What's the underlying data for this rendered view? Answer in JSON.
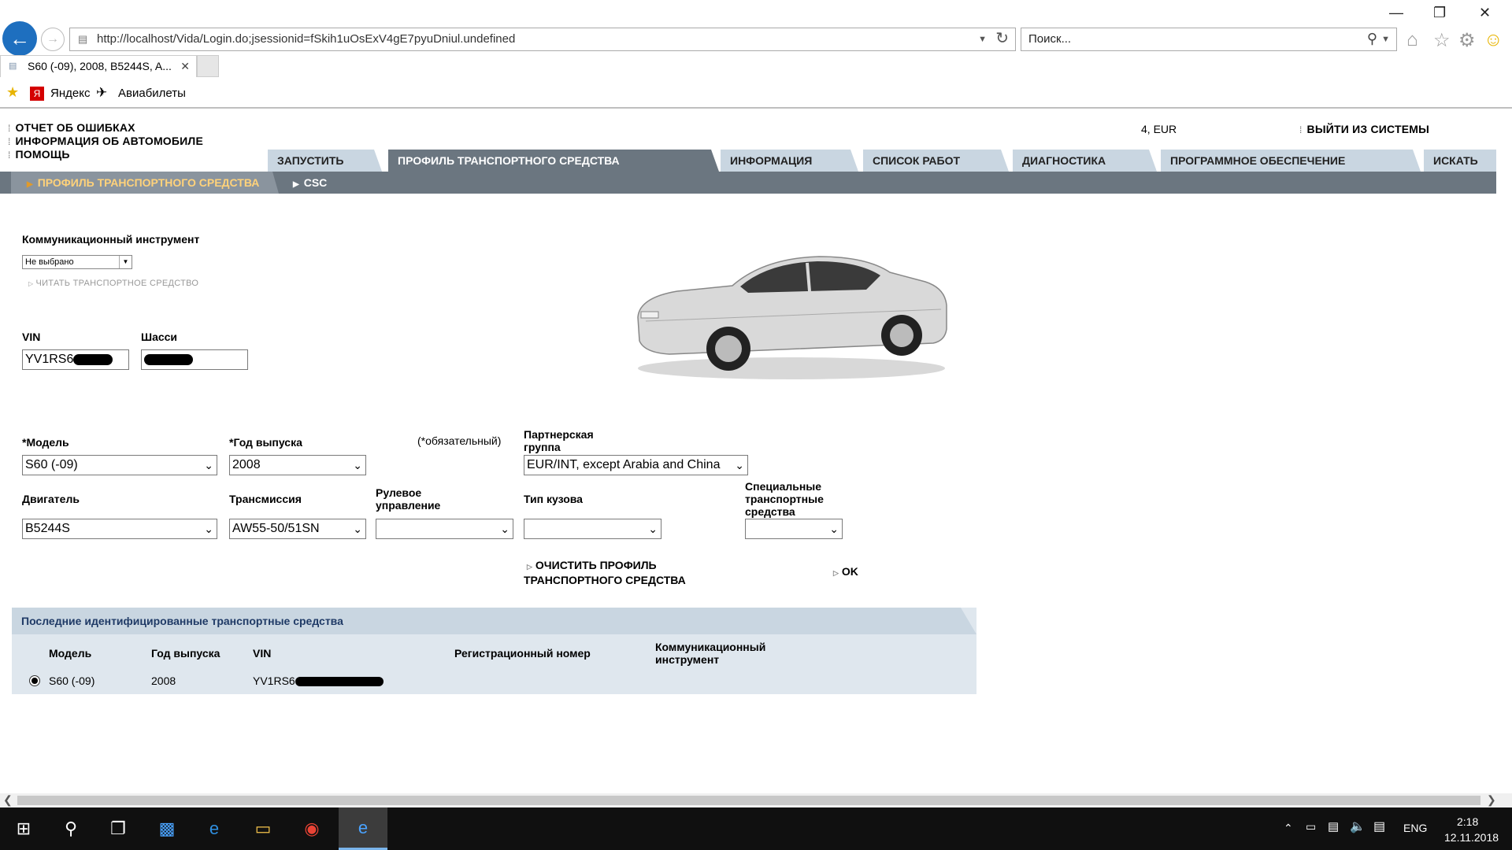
{
  "browser": {
    "address": "http://localhost/Vida/Login.do;jsessionid=fSkih1uOsExV4gE7pyuDniul.undefined",
    "search_placeholder": "Поиск...",
    "tab_title": "S60 (-09), 2008, B5244S, A...",
    "favorites": [
      "Яндекс",
      "Авиабилеты"
    ]
  },
  "header": {
    "links": [
      "ОТЧЕТ ОБ ОШИБКАХ",
      "ИНФОРМАЦИЯ ОБ АВТОМОБИЛЕ",
      "ПОМОЩЬ"
    ],
    "account": "4, EUR",
    "logout": "ВЫЙТИ ИЗ СИСТЕМЫ"
  },
  "menu": {
    "tabs": [
      "ЗАПУСТИТЬ",
      "ПРОФИЛЬ ТРАНСПОРТНОГО СРЕДСТВА",
      "ИНФОРМАЦИЯ",
      "СПИСОК РАБОТ",
      "ДИАГНОСТИКА",
      "ПРОГРАММНОЕ ОБЕСПЕЧЕНИЕ",
      "ИСКАТЬ"
    ],
    "active": "ПРОФИЛЬ ТРАНСПОРТНОГО СРЕДСТВА"
  },
  "submenu": {
    "items": [
      "ПРОФИЛЬ ТРАНСПОРТНОГО СРЕДСТВА",
      "CSC"
    ]
  },
  "comm": {
    "label": "Коммуникационный инструмент",
    "value": "Не выбрано",
    "read_link": "ЧИТАТЬ ТРАНСПОРТНОЕ СРЕДСТВО"
  },
  "vin": {
    "label": "VIN",
    "value": "YV1RS6"
  },
  "chassis": {
    "label": "Шасси",
    "value": ""
  },
  "profile": {
    "model_label": "*Модель",
    "model_value": "S60 (-09)",
    "year_label": "*Год выпуска",
    "year_value": "2008",
    "required_note": "(*обязательный)",
    "partner_label_1": "Партнерская",
    "partner_label_2": "группа",
    "partner_value": "EUR/INT, except Arabia and China",
    "engine_label": "Двигатель",
    "engine_value": "B5244S",
    "trans_label": "Трансмиссия",
    "trans_value": "AW55-50/51SN",
    "steering_label_1": "Рулевое",
    "steering_label_2": "управление",
    "steering_value": "",
    "body_label": "Тип кузова",
    "body_value": "",
    "special_label_1": "Специальные",
    "special_label_2": "транспортные",
    "special_label_3": "средства",
    "special_value": ""
  },
  "actions": {
    "clear_1": "ОЧИСТИТЬ ПРОФИЛЬ",
    "clear_2": "ТРАНСПОРТНОГО СРЕДСТВА",
    "ok": "OK"
  },
  "recent": {
    "title": "Последние идентифицированные транспортные средства",
    "headers": {
      "model": "Модель",
      "year": "Год выпуска",
      "vin": "VIN",
      "reg": "Регистрационный номер",
      "comm_1": "Коммуникационный",
      "comm_2": "инструмент"
    },
    "rows": [
      {
        "model": "S60 (-09)",
        "year": "2008",
        "vin": "YV1RS6",
        "selected": true
      }
    ]
  },
  "taskbar": {
    "language": "ENG",
    "time": "2:18",
    "date": "12.11.2018"
  },
  "colors": {
    "menu_tab": "#c9d6e1",
    "menu_active": "#6b7680",
    "sub_active_text": "#ffd27a",
    "panel": "#dfe7ee"
  }
}
